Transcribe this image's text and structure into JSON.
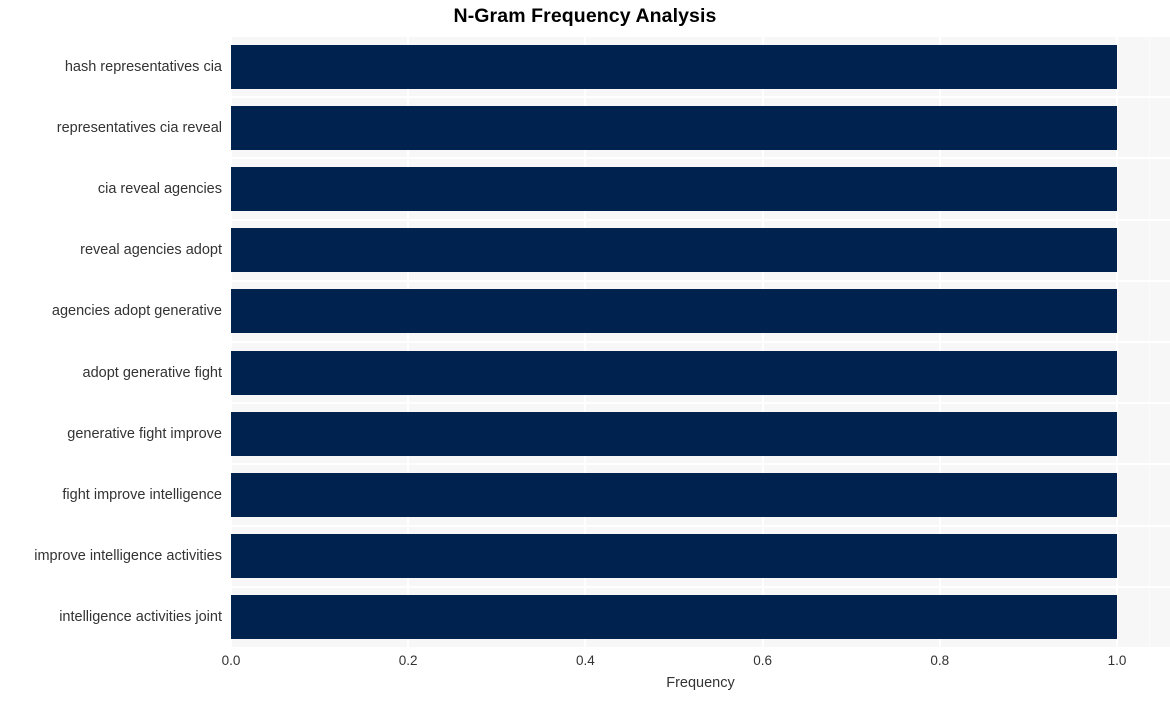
{
  "chart_data": {
    "type": "bar",
    "orientation": "horizontal",
    "title": "N-Gram Frequency Analysis",
    "xlabel": "Frequency",
    "ylabel": "",
    "categories": [
      "hash representatives cia",
      "representatives cia reveal",
      "cia reveal agencies",
      "reveal agencies adopt",
      "agencies adopt generative",
      "adopt generative fight",
      "generative fight improve",
      "fight improve intelligence",
      "improve intelligence activities",
      "intelligence activities joint"
    ],
    "values": [
      1.0,
      1.0,
      1.0,
      1.0,
      1.0,
      1.0,
      1.0,
      1.0,
      1.0,
      1.0
    ],
    "xticks": [
      "0.0",
      "0.2",
      "0.4",
      "0.6",
      "0.8",
      "1.0"
    ],
    "xtick_values": [
      0.0,
      0.2,
      0.4,
      0.6,
      0.8,
      1.0
    ],
    "xlim": [
      0.0,
      1.0
    ],
    "grid": true,
    "legend": null,
    "colors": {
      "bar": "#00224f",
      "plot_background": "#f7f7f7",
      "figure_background": "#ffffff",
      "gridline": "#ffffff",
      "title_text": "#000000",
      "tick_text": "#333333"
    }
  }
}
